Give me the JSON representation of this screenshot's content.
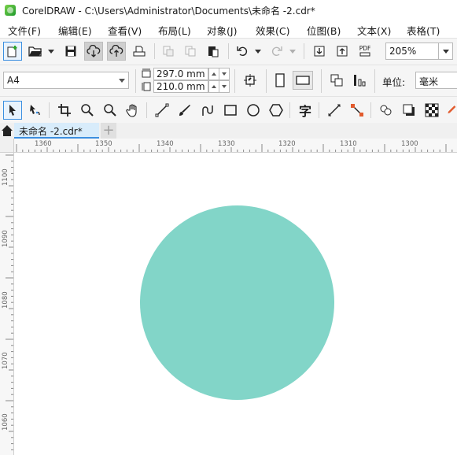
{
  "window": {
    "title": "CorelDRAW - C:\\Users\\Administrator\\Documents\\未命名 -2.cdr*"
  },
  "menu": [
    {
      "label": "文件(F)"
    },
    {
      "label": "编辑(E)"
    },
    {
      "label": "查看(V)"
    },
    {
      "label": "布局(L)"
    },
    {
      "label": "对象(J)"
    },
    {
      "label": "效果(C)"
    },
    {
      "label": "位图(B)"
    },
    {
      "label": "文本(X)"
    },
    {
      "label": "表格(T)"
    }
  ],
  "standard_toolbar": {
    "zoom_value": "205%",
    "pdf_label": "PDF"
  },
  "property_bar": {
    "page_size_preset": "A4",
    "page_width": "297.0 mm",
    "page_height": "210.0 mm",
    "units_label": "单位:",
    "units_value": "毫米"
  },
  "toolbox_text_tool_glyph": "字",
  "document_tab": {
    "label": "未命名 -2.cdr*",
    "add_symbol": "+"
  },
  "rulers": {
    "horizontal": [
      "1360",
      "1350",
      "1340",
      "1330",
      "1320",
      "1310",
      "1300"
    ],
    "vertical": [
      "1100",
      "1090",
      "1080",
      "1070",
      "1060"
    ]
  },
  "canvas": {
    "shape": "circle",
    "fill_color": "#82d5c8"
  },
  "colors": {
    "accent": "#3b8fe0",
    "toolbar_bg": "#f5f5f5"
  }
}
